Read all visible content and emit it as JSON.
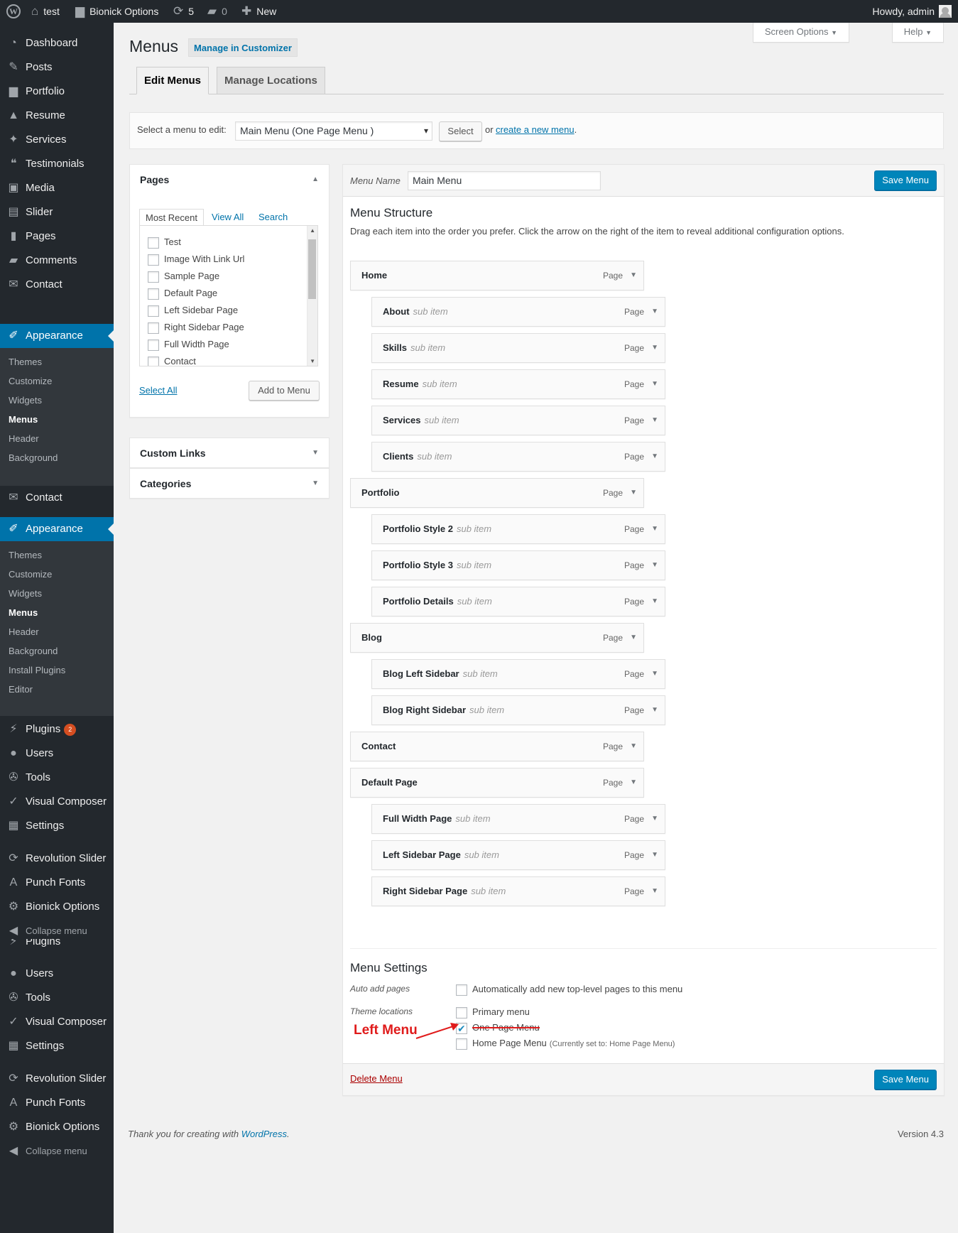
{
  "adminbar": {
    "site": "test",
    "options": "Bionick Options",
    "updates": "5",
    "comments": "0",
    "new": "New",
    "howdy": "Howdy, admin"
  },
  "sidebar": {
    "top": [
      {
        "label": "Dashboard",
        "icon": "dashboard-icon",
        "glyph": "◔"
      },
      {
        "label": "Posts",
        "icon": "pin-icon",
        "glyph": "✎"
      },
      {
        "label": "Portfolio",
        "icon": "folder-icon",
        "glyph": "▆"
      },
      {
        "label": "Resume",
        "icon": "graduation-cap-icon",
        "glyph": "▲"
      },
      {
        "label": "Services",
        "icon": "wrench-icon",
        "glyph": "✦"
      },
      {
        "label": "Testimonials",
        "icon": "quote-icon",
        "glyph": "❝"
      },
      {
        "label": "Media",
        "icon": "media-icon",
        "glyph": "▣"
      },
      {
        "label": "Slider",
        "icon": "slider-icon",
        "glyph": "▤"
      },
      {
        "label": "Pages",
        "icon": "pages-icon",
        "glyph": "▮"
      },
      {
        "label": "Comments",
        "icon": "comment-icon",
        "glyph": "▰"
      },
      {
        "label": "Contact",
        "icon": "mail-icon",
        "glyph": "✉"
      }
    ],
    "appearance": "Appearance",
    "sub1": [
      "Themes",
      "Customize",
      "Widgets",
      "Menus",
      "Header",
      "Background"
    ],
    "contact2": "Contact",
    "sub2": [
      "Themes",
      "Customize",
      "Widgets",
      "Menus",
      "Header",
      "Background",
      "Install Plugins",
      "Editor"
    ],
    "plugins": "Plugins",
    "plugins_badge": "2",
    "bottom1": [
      {
        "label": "Users",
        "icon": "user-icon",
        "glyph": "●"
      },
      {
        "label": "Tools",
        "icon": "tools-icon",
        "glyph": "✇"
      },
      {
        "label": "Visual Composer",
        "icon": "visual-composer-icon",
        "glyph": "✓"
      },
      {
        "label": "Settings",
        "icon": "settings-icon",
        "glyph": "▦"
      }
    ],
    "bottom2": [
      {
        "label": "Revolution Slider",
        "icon": "revolution-slider-icon",
        "glyph": "⟳"
      },
      {
        "label": "Punch Fonts",
        "icon": "font-icon",
        "glyph": "A"
      },
      {
        "label": "Bionick Options",
        "icon": "gear-icon",
        "glyph": "⚙"
      }
    ],
    "collapse": "Collapse menu"
  },
  "header": {
    "screen_options": "Screen Options",
    "help": "Help",
    "title": "Menus",
    "manage_customizer": "Manage in Customizer",
    "tabs": [
      "Edit Menus",
      "Manage Locations"
    ]
  },
  "select_menu": {
    "label": "Select a menu to edit:",
    "value": "Main Menu (One Page Menu )",
    "select_btn": "Select",
    "or": "or",
    "create": "create a new menu",
    "period": "."
  },
  "pages_box": {
    "title": "Pages",
    "tabs": [
      "Most Recent",
      "View All",
      "Search"
    ],
    "items": [
      "Test",
      "Image With Link Url",
      "Sample Page",
      "Default Page",
      "Left Sidebar Page",
      "Right Sidebar Page",
      "Full Width Page",
      "Contact"
    ],
    "select_all": "Select All",
    "add": "Add to Menu"
  },
  "custom_links": "Custom Links",
  "categories": "Categories",
  "menu": {
    "name_label": "Menu Name",
    "name_value": "Main Menu",
    "save": "Save Menu",
    "structure_title": "Menu Structure",
    "structure_desc": "Drag each item into the order you prefer. Click the arrow on the right of the item to reveal additional configuration options.",
    "type": "Page",
    "sub_label": "sub item",
    "items": [
      {
        "title": "Home",
        "depth": 0
      },
      {
        "title": "About",
        "depth": 1
      },
      {
        "title": "Skills",
        "depth": 1
      },
      {
        "title": "Resume",
        "depth": 1
      },
      {
        "title": "Services",
        "depth": 1
      },
      {
        "title": "Clients",
        "depth": 1
      },
      {
        "title": "Portfolio",
        "depth": 0
      },
      {
        "title": "Portfolio Style 2",
        "depth": 1
      },
      {
        "title": "Portfolio Style 3",
        "depth": 1
      },
      {
        "title": "Portfolio Details",
        "depth": 1
      },
      {
        "title": "Blog",
        "depth": 0
      },
      {
        "title": "Blog Left Sidebar",
        "depth": 1
      },
      {
        "title": "Blog Right Sidebar",
        "depth": 1
      },
      {
        "title": "Contact",
        "depth": 0
      },
      {
        "title": "Default Page",
        "depth": 0
      },
      {
        "title": "Full Width Page",
        "depth": 1
      },
      {
        "title": "Left Sidebar Page",
        "depth": 1
      },
      {
        "title": "Right Sidebar Page",
        "depth": 1
      }
    ],
    "settings_title": "Menu Settings",
    "auto_add_label": "Auto add pages",
    "auto_add_text": "Automatically add new top-level pages to this menu",
    "locations_label": "Theme locations",
    "locations": [
      {
        "label": "Primary menu",
        "checked": false,
        "note": ""
      },
      {
        "label": "One Page Menu",
        "checked": true,
        "note": ""
      },
      {
        "label": "Home Page Menu",
        "checked": false,
        "note": "(Currently set to: Home Page Menu)"
      }
    ],
    "annotation": "Left Menu",
    "delete": "Delete Menu"
  },
  "footer": {
    "thanks": "Thank you for creating with ",
    "wp": "WordPress",
    "period": ".",
    "version": "Version 4.3"
  },
  "colors": {
    "accent": "#0073aa",
    "primary_button": "#0085ba",
    "annotation": "#e01b1b",
    "sidebar_bg": "#23282d"
  }
}
